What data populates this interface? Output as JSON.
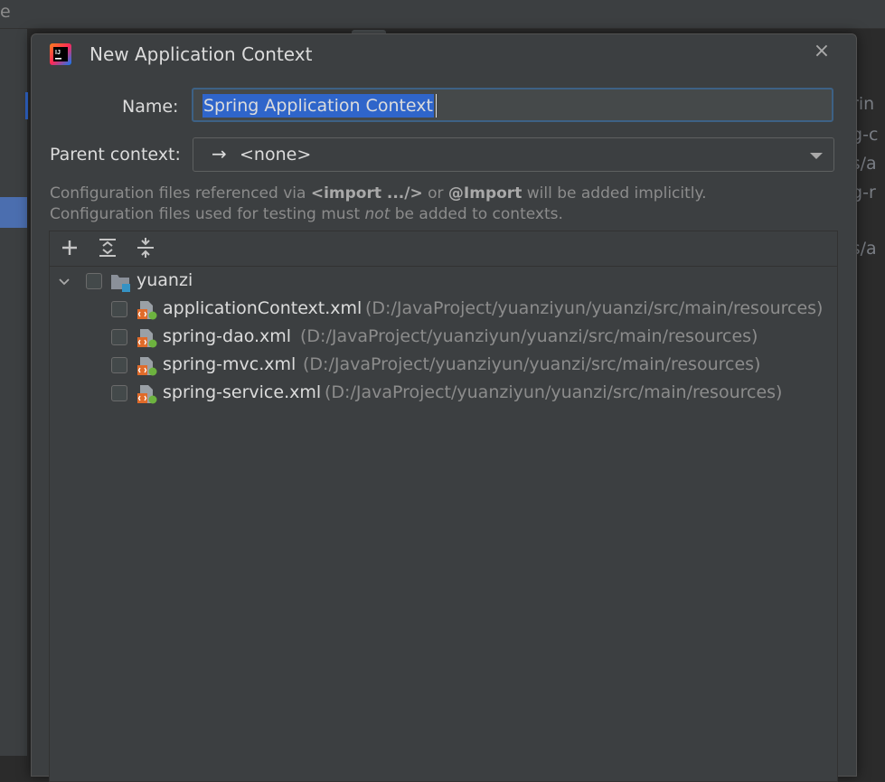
{
  "background": {
    "top_fragment": "e",
    "right_fragments": [
      "prin",
      "ng-c",
      "es/a",
      "ng-r",
      "es/a"
    ]
  },
  "dialog": {
    "title": "New Application Context",
    "close_symbol": "×",
    "name_label": "Name:",
    "name_value": "Spring Application Context",
    "parent_label": "Parent context:",
    "parent_arrow": "→",
    "parent_value": "<none>",
    "info_line1": {
      "pre": "Configuration files referenced via ",
      "b1": "<import .../>",
      "mid": " or ",
      "b2": "@Import",
      "post": " will be added implicitly."
    },
    "info_line2": {
      "pre": "Configuration files used for testing must ",
      "em": "not",
      "post": " be added to contexts."
    },
    "toolbar": {
      "add_icon": "plus-icon",
      "expand_icon": "expand-all-icon",
      "collapse_icon": "collapse-all-icon"
    },
    "tree": {
      "root": {
        "label": "yuanzi",
        "icon": "module-folder-icon",
        "expanded": true,
        "checked": false
      },
      "files": [
        {
          "name": "applicationContext.xml",
          "path": "(D:/JavaProject/yuanziyun/yuanzi/src/main/resources)",
          "checked": false
        },
        {
          "name": "spring-dao.xml",
          "path": "(D:/JavaProject/yuanziyun/yuanzi/src/main/resources)",
          "checked": false
        },
        {
          "name": "spring-mvc.xml",
          "path": "(D:/JavaProject/yuanziyun/yuanzi/src/main/resources)",
          "checked": false
        },
        {
          "name": "spring-service.xml",
          "path": "(D:/JavaProject/yuanziyun/yuanzi/src/main/resources)",
          "checked": false
        }
      ]
    }
  },
  "colors": {
    "dialog_bg": "#3c3f41",
    "selection": "#2f65ca",
    "focus_border": "#3d6185",
    "text": "#dcdcdc",
    "muted_text": "#8c8c8c"
  }
}
